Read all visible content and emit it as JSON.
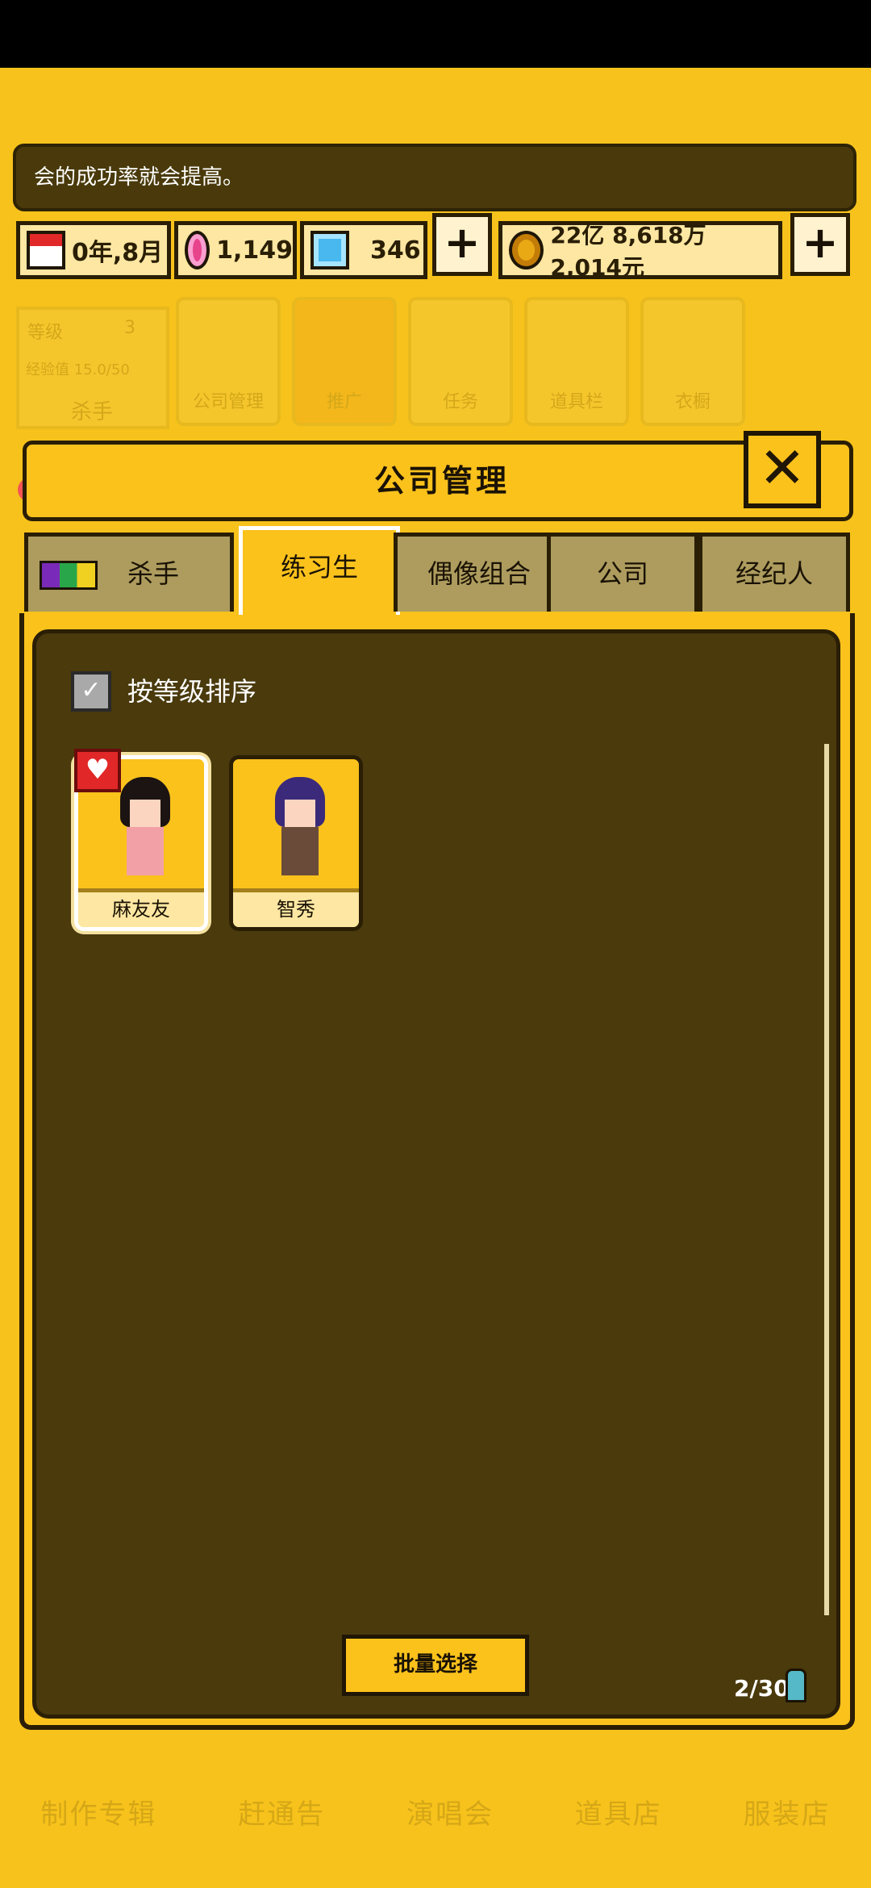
{
  "notice": "会的成功率就会提高。",
  "resources": {
    "date": "0年,8月",
    "gems": "1,149",
    "diamonds": "346",
    "money": "22亿 8,618万 2,014元"
  },
  "plus_label": "+",
  "bg_stats": {
    "level_label": "等级",
    "level": "3",
    "exp": "经验值 15.0/50",
    "name": "杀手"
  },
  "bg_menu": [
    "公司管理",
    "推广",
    "任务",
    "道具栏",
    "衣橱"
  ],
  "dialog": {
    "title": "公司管理",
    "close": "✕",
    "tabs": [
      "杀手",
      "练习生",
      "偶像组合",
      "公司",
      "经纪人"
    ],
    "active_tab": "练习生",
    "sort_label": "按等级排序",
    "trainees": [
      {
        "name": "麻友友",
        "favorite": true,
        "hair": "#1c1412",
        "outfit": "#f2a0a6"
      },
      {
        "name": "智秀",
        "favorite": false,
        "hair": "#3b2a7a",
        "outfit": "#6a4b3a"
      }
    ],
    "batch_button": "批量选择",
    "count": "2/30"
  },
  "bottom_nav": [
    "制作专辑",
    "赶通告",
    "演唱会",
    "道具店",
    "服装店"
  ]
}
